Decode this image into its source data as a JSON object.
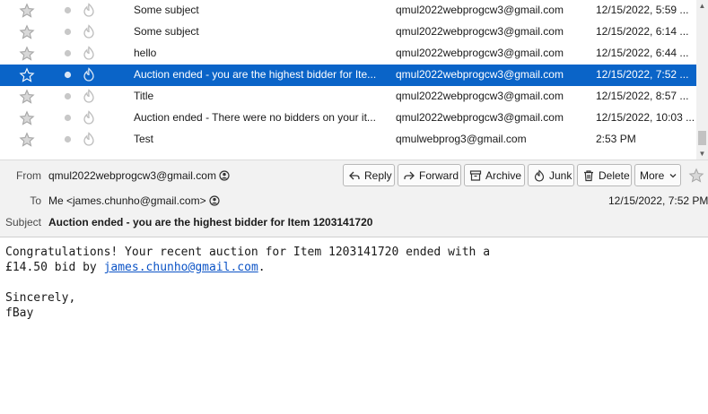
{
  "messages": [
    {
      "subject": "Some subject",
      "from": "qmul2022webprogcw3@gmail.com",
      "date": "12/15/2022, 5:59 ...",
      "selected": false
    },
    {
      "subject": "Some subject",
      "from": "qmul2022webprogcw3@gmail.com",
      "date": "12/15/2022, 6:14 ...",
      "selected": false
    },
    {
      "subject": "hello",
      "from": "qmul2022webprogcw3@gmail.com",
      "date": "12/15/2022, 6:44 ...",
      "selected": false
    },
    {
      "subject": "Auction ended - you are the highest bidder for Ite...",
      "from": "qmul2022webprogcw3@gmail.com",
      "date": "12/15/2022, 7:52 ...",
      "selected": true
    },
    {
      "subject": "Title",
      "from": "qmul2022webprogcw3@gmail.com",
      "date": "12/15/2022, 8:57 ...",
      "selected": false
    },
    {
      "subject": "Auction ended - There were no bidders on your it...",
      "from": "qmul2022webprogcw3@gmail.com",
      "date": "12/15/2022, 10:03 ...",
      "selected": false
    },
    {
      "subject": "Test",
      "from": "qmulwebprog3@gmail.com",
      "date": "2:53 PM",
      "selected": false
    }
  ],
  "header": {
    "from_label": "From",
    "from_value": "qmul2022webprogcw3@gmail.com",
    "to_label": "To",
    "to_value": "Me <james.chunho@gmail.com>",
    "subject_label": "Subject",
    "subject_value": "Auction ended - you are the highest bidder for Item 1203141720",
    "date": "12/15/2022, 7:52 PM"
  },
  "toolbar": {
    "reply": "Reply",
    "forward": "Forward",
    "archive": "Archive",
    "junk": "Junk",
    "delete": "Delete",
    "more": "More"
  },
  "body": {
    "line1": "Congratulations! Your recent auction for Item 1203141720 ended with a",
    "line2_prefix": "£14.50 bid by ",
    "line2_link": "james.chunho@gmail.com",
    "line2_suffix": ".",
    "closing": "Sincerely,",
    "signature": "fBay"
  },
  "colors": {
    "selection": "#0a64c8",
    "link": "#0b53c6",
    "header_bg": "#f2f2f2"
  },
  "icons": [
    "star-icon",
    "read-status-icon",
    "junk-status-icon",
    "contact-icon",
    "reply-icon",
    "forward-icon",
    "archive-icon",
    "junk-icon",
    "delete-icon",
    "chevron-down-icon",
    "scroll-up-icon",
    "scroll-down-icon"
  ]
}
